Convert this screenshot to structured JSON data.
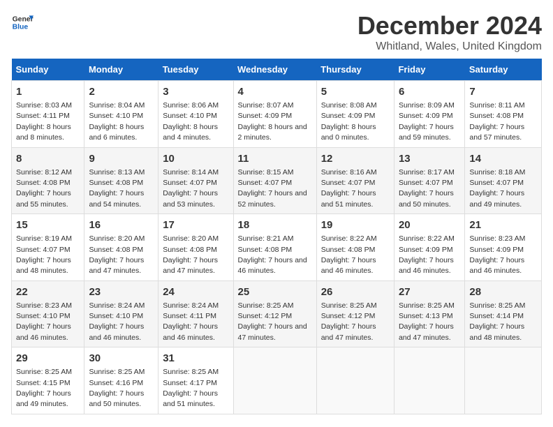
{
  "logo": {
    "line1": "General",
    "line2": "Blue"
  },
  "header": {
    "month": "December 2024",
    "location": "Whitland, Wales, United Kingdom"
  },
  "days_of_week": [
    "Sunday",
    "Monday",
    "Tuesday",
    "Wednesday",
    "Thursday",
    "Friday",
    "Saturday"
  ],
  "weeks": [
    [
      {
        "day": "1",
        "sunrise": "8:03 AM",
        "sunset": "4:11 PM",
        "daylight": "8 hours and 8 minutes."
      },
      {
        "day": "2",
        "sunrise": "8:04 AM",
        "sunset": "4:10 PM",
        "daylight": "8 hours and 6 minutes."
      },
      {
        "day": "3",
        "sunrise": "8:06 AM",
        "sunset": "4:10 PM",
        "daylight": "8 hours and 4 minutes."
      },
      {
        "day": "4",
        "sunrise": "8:07 AM",
        "sunset": "4:09 PM",
        "daylight": "8 hours and 2 minutes."
      },
      {
        "day": "5",
        "sunrise": "8:08 AM",
        "sunset": "4:09 PM",
        "daylight": "8 hours and 0 minutes."
      },
      {
        "day": "6",
        "sunrise": "8:09 AM",
        "sunset": "4:09 PM",
        "daylight": "7 hours and 59 minutes."
      },
      {
        "day": "7",
        "sunrise": "8:11 AM",
        "sunset": "4:08 PM",
        "daylight": "7 hours and 57 minutes."
      }
    ],
    [
      {
        "day": "8",
        "sunrise": "8:12 AM",
        "sunset": "4:08 PM",
        "daylight": "7 hours and 55 minutes."
      },
      {
        "day": "9",
        "sunrise": "8:13 AM",
        "sunset": "4:08 PM",
        "daylight": "7 hours and 54 minutes."
      },
      {
        "day": "10",
        "sunrise": "8:14 AM",
        "sunset": "4:07 PM",
        "daylight": "7 hours and 53 minutes."
      },
      {
        "day": "11",
        "sunrise": "8:15 AM",
        "sunset": "4:07 PM",
        "daylight": "7 hours and 52 minutes."
      },
      {
        "day": "12",
        "sunrise": "8:16 AM",
        "sunset": "4:07 PM",
        "daylight": "7 hours and 51 minutes."
      },
      {
        "day": "13",
        "sunrise": "8:17 AM",
        "sunset": "4:07 PM",
        "daylight": "7 hours and 50 minutes."
      },
      {
        "day": "14",
        "sunrise": "8:18 AM",
        "sunset": "4:07 PM",
        "daylight": "7 hours and 49 minutes."
      }
    ],
    [
      {
        "day": "15",
        "sunrise": "8:19 AM",
        "sunset": "4:07 PM",
        "daylight": "7 hours and 48 minutes."
      },
      {
        "day": "16",
        "sunrise": "8:20 AM",
        "sunset": "4:08 PM",
        "daylight": "7 hours and 47 minutes."
      },
      {
        "day": "17",
        "sunrise": "8:20 AM",
        "sunset": "4:08 PM",
        "daylight": "7 hours and 47 minutes."
      },
      {
        "day": "18",
        "sunrise": "8:21 AM",
        "sunset": "4:08 PM",
        "daylight": "7 hours and 46 minutes."
      },
      {
        "day": "19",
        "sunrise": "8:22 AM",
        "sunset": "4:08 PM",
        "daylight": "7 hours and 46 minutes."
      },
      {
        "day": "20",
        "sunrise": "8:22 AM",
        "sunset": "4:09 PM",
        "daylight": "7 hours and 46 minutes."
      },
      {
        "day": "21",
        "sunrise": "8:23 AM",
        "sunset": "4:09 PM",
        "daylight": "7 hours and 46 minutes."
      }
    ],
    [
      {
        "day": "22",
        "sunrise": "8:23 AM",
        "sunset": "4:10 PM",
        "daylight": "7 hours and 46 minutes."
      },
      {
        "day": "23",
        "sunrise": "8:24 AM",
        "sunset": "4:10 PM",
        "daylight": "7 hours and 46 minutes."
      },
      {
        "day": "24",
        "sunrise": "8:24 AM",
        "sunset": "4:11 PM",
        "daylight": "7 hours and 46 minutes."
      },
      {
        "day": "25",
        "sunrise": "8:25 AM",
        "sunset": "4:12 PM",
        "daylight": "7 hours and 47 minutes."
      },
      {
        "day": "26",
        "sunrise": "8:25 AM",
        "sunset": "4:12 PM",
        "daylight": "7 hours and 47 minutes."
      },
      {
        "day": "27",
        "sunrise": "8:25 AM",
        "sunset": "4:13 PM",
        "daylight": "7 hours and 47 minutes."
      },
      {
        "day": "28",
        "sunrise": "8:25 AM",
        "sunset": "4:14 PM",
        "daylight": "7 hours and 48 minutes."
      }
    ],
    [
      {
        "day": "29",
        "sunrise": "8:25 AM",
        "sunset": "4:15 PM",
        "daylight": "7 hours and 49 minutes."
      },
      {
        "day": "30",
        "sunrise": "8:25 AM",
        "sunset": "4:16 PM",
        "daylight": "7 hours and 50 minutes."
      },
      {
        "day": "31",
        "sunrise": "8:25 AM",
        "sunset": "4:17 PM",
        "daylight": "7 hours and 51 minutes."
      },
      null,
      null,
      null,
      null
    ]
  ],
  "labels": {
    "sunrise": "Sunrise:",
    "sunset": "Sunset:",
    "daylight": "Daylight:"
  }
}
